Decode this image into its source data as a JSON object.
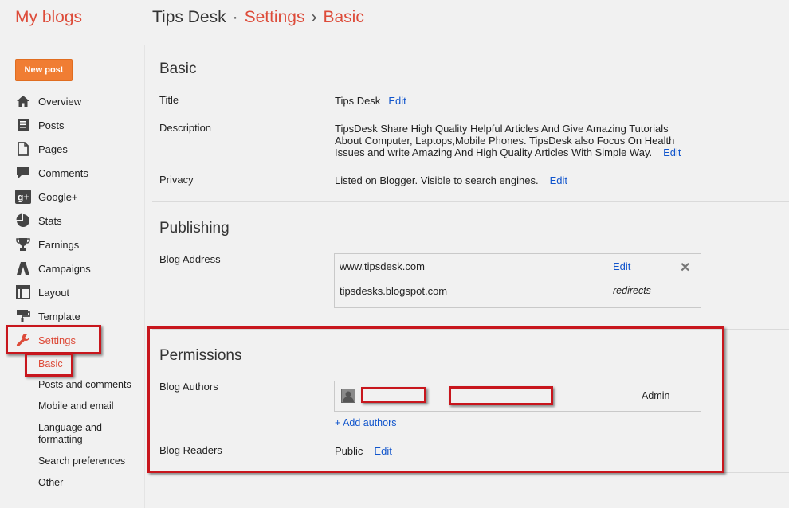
{
  "header": {
    "brand": "My blogs",
    "blog_name": "Tips Desk",
    "separator_dot": "·",
    "settings": "Settings",
    "separator_arrow": "›",
    "current": "Basic"
  },
  "sidebar": {
    "new_post": "New post",
    "items": [
      {
        "label": "Overview",
        "icon": "home-icon"
      },
      {
        "label": "Posts",
        "icon": "posts-icon"
      },
      {
        "label": "Pages",
        "icon": "pages-icon"
      },
      {
        "label": "Comments",
        "icon": "comments-icon"
      },
      {
        "label": "Google+",
        "icon": "google-plus-icon"
      },
      {
        "label": "Stats",
        "icon": "stats-icon"
      },
      {
        "label": "Earnings",
        "icon": "trophy-icon"
      },
      {
        "label": "Campaigns",
        "icon": "campaigns-icon"
      },
      {
        "label": "Layout",
        "icon": "layout-icon"
      },
      {
        "label": "Template",
        "icon": "template-icon"
      },
      {
        "label": "Settings",
        "icon": "wrench-icon",
        "active": true
      }
    ],
    "settings_sub": [
      {
        "label": "Basic",
        "active": true
      },
      {
        "label": "Posts and comments"
      },
      {
        "label": "Mobile and email"
      },
      {
        "label": "Language and\nformatting"
      },
      {
        "label": "Search preferences"
      },
      {
        "label": "Other"
      }
    ]
  },
  "basic": {
    "title": "Basic",
    "title_label": "Title",
    "title_value": "Tips Desk",
    "description_label": "Description",
    "description_line1": "TipsDesk Share High Quality Helpful Articles And Give Amazing Tutorials",
    "description_line2": "About Computer, Laptops,Mobile Phones. TipsDesk also Focus On Health",
    "description_line3": "Issues and write Amazing And High Quality Articles With Simple Way.",
    "privacy_label": "Privacy",
    "privacy_value": "Listed on Blogger. Visible to search engines.",
    "edit": "Edit"
  },
  "publishing": {
    "title": "Publishing",
    "address_label": "Blog Address",
    "custom_domain": "www.tipsdesk.com",
    "edit": "Edit",
    "remove": "✕",
    "blogspot_domain": "tipsdesks.blogspot.com",
    "redirects": "redirects"
  },
  "permissions": {
    "title": "Permissions",
    "authors_label": "Blog Authors",
    "author_role": "Admin",
    "add_authors": "+ Add authors",
    "readers_label": "Blog Readers",
    "readers_value": "Public",
    "edit": "Edit"
  },
  "colors": {
    "accent": "#dd4b39",
    "button": "#f07d33",
    "link": "#1155cc",
    "highlight": "#c8161d"
  }
}
